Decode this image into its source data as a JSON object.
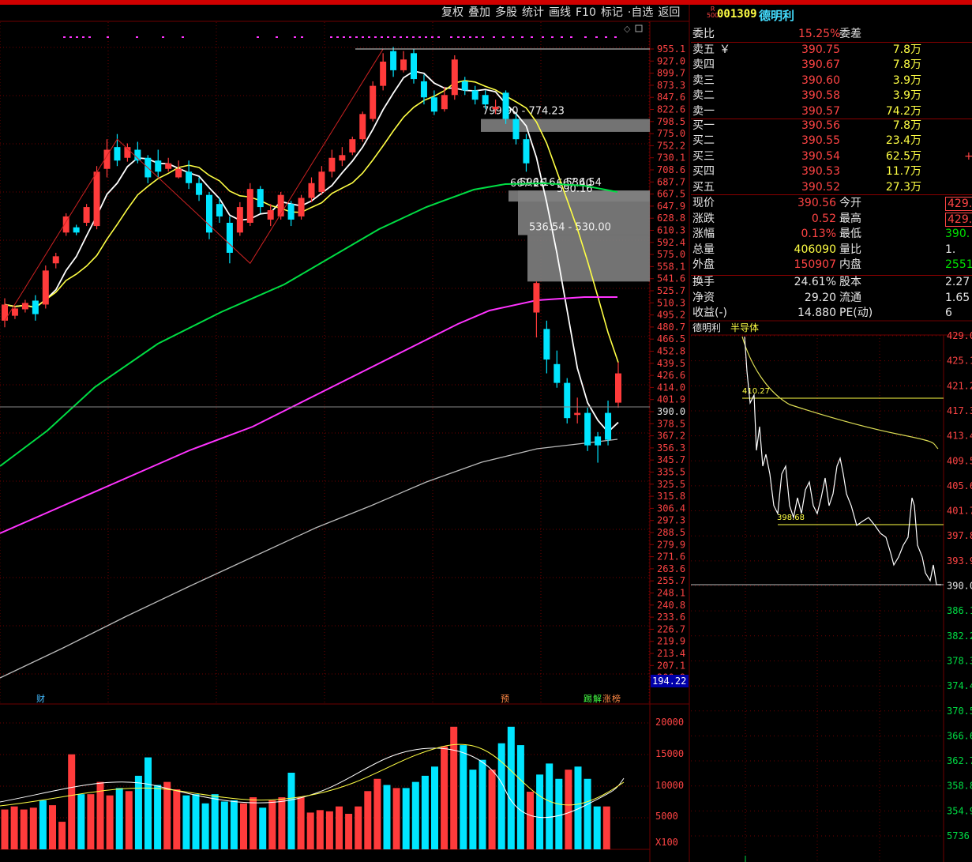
{
  "toolbar": [
    "复权",
    "叠加",
    "多股",
    "统计",
    "画线",
    "F10",
    "标记",
    "·自选",
    "返回"
  ],
  "stock": {
    "badge_top": "R",
    "badge_bottom": "500",
    "code": "001309",
    "name": "德明利"
  },
  "colors": {
    "up": "#ff3b3b",
    "down": "#00e5ff",
    "ma5": "#ffffff",
    "ma10": "#ffff44",
    "ma30": "#00dd44",
    "ma60": "#ff33ff",
    "ma120": "#bbbbbb",
    "grid": "#6e0000",
    "panel_bg": "#808080"
  },
  "orderbook": {
    "ratio_label": "委比",
    "ratio_value": "15.25%",
    "diff_label": "委差",
    "sells": [
      {
        "label": "卖五",
        "mark": "￥",
        "price": "390.75",
        "vol": "7.8万"
      },
      {
        "label": "卖四",
        "mark": "",
        "price": "390.67",
        "vol": "7.8万"
      },
      {
        "label": "卖三",
        "mark": "",
        "price": "390.60",
        "vol": "3.9万"
      },
      {
        "label": "卖二",
        "mark": "",
        "price": "390.58",
        "vol": "3.9万"
      },
      {
        "label": "卖一",
        "mark": "",
        "price": "390.57",
        "vol": "74.2万"
      }
    ],
    "buys": [
      {
        "label": "买一",
        "price": "390.56",
        "vol": "7.8万",
        "extra": ""
      },
      {
        "label": "买二",
        "price": "390.55",
        "vol": "23.4万",
        "extra": ""
      },
      {
        "label": "买三",
        "price": "390.54",
        "vol": "62.5万",
        "extra": "+"
      },
      {
        "label": "买四",
        "price": "390.53",
        "vol": "11.7万",
        "extra": ""
      },
      {
        "label": "买五",
        "price": "390.52",
        "vol": "27.3万",
        "extra": ""
      }
    ]
  },
  "quote": [
    {
      "l1": "现价",
      "v1": "390.56",
      "c1": "red",
      "l2": "今开",
      "v2": "429.",
      "c2": "red",
      "box": true
    },
    {
      "l1": "涨跌",
      "v1": "0.52",
      "c1": "red",
      "l2": "最高",
      "v2": "429.",
      "c2": "red",
      "box": true
    },
    {
      "l1": "涨幅",
      "v1": "0.13%",
      "c1": "red",
      "l2": "最低",
      "v2": "390.",
      "c2": "grn",
      "box": false
    },
    {
      "l1": "总量",
      "v1": "406090",
      "c1": "yel",
      "l2": "量比",
      "v2": "1.",
      "c2": "wht",
      "box": false
    },
    {
      "l1": "外盘",
      "v1": "150907",
      "c1": "red",
      "l2": "内盘",
      "v2": "2551",
      "c2": "grn",
      "box": false
    },
    {
      "l1": "换手",
      "v1": "24.61%",
      "c1": "wht",
      "l2": "股本",
      "v2": "2.27",
      "c2": "wht",
      "box": false
    },
    {
      "l1": "净资",
      "v1": "29.20",
      "c1": "wht",
      "l2": "流通",
      "v2": "1.65",
      "c2": "wht",
      "box": false
    },
    {
      "l1": "收益(-)",
      "v1": "14.880",
      "c1": "wht",
      "l2": "PE(动)",
      "v2": "6",
      "c2": "wht",
      "box": false
    }
  ],
  "mini": {
    "name": "德明利",
    "sector": "半导体",
    "labels": [
      "429.0",
      "425.1",
      "421.2",
      "417.3",
      "413.4",
      "409.5",
      "405.6",
      "401.7",
      "397.8",
      "393.9",
      "390.0",
      "386.1",
      "382.2",
      "378.3",
      "374.4",
      "370.5",
      "366.6",
      "362.7",
      "358.8",
      "354.9",
      "5736"
    ],
    "markers": [
      "410.27",
      "398.68"
    ]
  },
  "price_axis": [
    "955.1",
    "927.0",
    "899.7",
    "873.3",
    "847.6",
    "822.6",
    "798.5",
    "775.0",
    "752.2",
    "730.1",
    "708.6",
    "687.7",
    "667.5",
    "647.9",
    "628.8",
    "610.3",
    "592.4",
    "575.0",
    "558.1",
    "541.6",
    "525.7",
    "510.3",
    "495.2",
    "480.7",
    "466.5",
    "452.8",
    "439.5",
    "426.6",
    "414.0",
    "401.9",
    "390.0",
    "378.5",
    "367.2",
    "356.3",
    "345.7",
    "335.5",
    "325.5",
    "315.8",
    "306.4",
    "297.3",
    "288.5",
    "279.9",
    "271.6",
    "263.6",
    "255.7",
    "248.1",
    "240.8",
    "233.6",
    "226.7",
    "219.9",
    "213.4",
    "207.1",
    "200.9"
  ],
  "cur_price_label": "194.22",
  "vol_axis": [
    "20000",
    "15000",
    "10000",
    "5000",
    "X100"
  ],
  "zones": [
    {
      "label": "799.90 - 774.23",
      "lo": 774.23,
      "hi": 799.9
    },
    {
      "label": "667.26 - 667.40",
      "lo": 660,
      "hi": 667.4
    },
    {
      "label": "596.16 - 536.54",
      "lo": 596.16,
      "hi": 667.26
    },
    {
      "label": "536.54 - 530.00",
      "lo": 530,
      "hi": 596.16
    }
  ],
  "zone_overlay": "590.16",
  "chart_markers": [
    "财",
    "预",
    "踢",
    "解",
    "涨",
    "榜"
  ],
  "chart_data": {
    "type": "candlestick",
    "candles": [
      [
        480,
        500,
        472,
        508
      ],
      [
        486,
        495,
        482,
        498
      ],
      [
        494,
        502,
        490,
        506
      ],
      [
        505,
        488,
        480,
        512
      ],
      [
        500,
        545,
        495,
        552
      ],
      [
        555,
        565,
        548,
        570
      ],
      [
        600,
        625,
        595,
        630
      ],
      [
        608,
        600,
        596,
        612
      ],
      [
        615,
        640,
        610,
        645
      ],
      [
        610,
        700,
        605,
        710
      ],
      [
        705,
        740,
        690,
        760
      ],
      [
        745,
        720,
        710,
        770
      ],
      [
        725,
        745,
        718,
        752
      ],
      [
        740,
        720,
        715,
        755
      ],
      [
        725,
        690,
        680,
        730
      ],
      [
        720,
        700,
        690,
        740
      ],
      [
        705,
        715,
        700,
        725
      ],
      [
        690,
        705,
        688,
        720
      ],
      [
        700,
        680,
        670,
        720
      ],
      [
        680,
        660,
        650,
        690
      ],
      [
        660,
        600,
        590,
        665
      ],
      [
        645,
        625,
        615,
        655
      ],
      [
        615,
        570,
        555,
        625
      ],
      [
        600,
        640,
        595,
        648
      ],
      [
        615,
        670,
        610,
        680
      ],
      [
        670,
        640,
        630,
        675
      ],
      [
        620,
        635,
        610,
        645
      ],
      [
        625,
        660,
        620,
        665
      ],
      [
        645,
        620,
        610,
        650
      ],
      [
        625,
        655,
        620,
        660
      ],
      [
        655,
        680,
        648,
        690
      ],
      [
        665,
        700,
        660,
        710
      ],
      [
        700,
        725,
        690,
        740
      ],
      [
        720,
        730,
        710,
        745
      ],
      [
        735,
        760,
        730,
        765
      ],
      [
        760,
        810,
        755,
        815
      ],
      [
        800,
        870,
        795,
        880
      ],
      [
        870,
        925,
        860,
        945
      ],
      [
        950,
        905,
        890,
        960
      ],
      [
        905,
        930,
        900,
        950
      ],
      [
        945,
        885,
        875,
        955
      ],
      [
        880,
        845,
        830,
        895
      ],
      [
        845,
        815,
        808,
        860
      ],
      [
        820,
        850,
        815,
        868
      ],
      [
        850,
        930,
        840,
        940
      ],
      [
        880,
        860,
        850,
        890
      ],
      [
        860,
        840,
        830,
        870
      ],
      [
        850,
        830,
        820,
        860
      ],
      [
        820,
        825,
        810,
        840
      ],
      [
        855,
        800,
        790,
        860
      ],
      [
        800,
        760,
        750,
        810
      ],
      [
        760,
        715,
        700,
        770
      ],
      [
        490,
        528,
        460,
        530
      ],
      [
        470,
        435,
        420,
        480
      ],
      [
        430,
        410,
        405,
        445
      ],
      [
        410,
        375,
        370,
        415
      ],
      [
        378,
        380,
        370,
        395
      ],
      [
        380,
        350,
        345,
        385
      ],
      [
        358,
        350,
        335,
        362
      ],
      [
        380,
        355,
        350,
        392
      ],
      [
        390,
        420,
        385,
        432
      ]
    ]
  }
}
